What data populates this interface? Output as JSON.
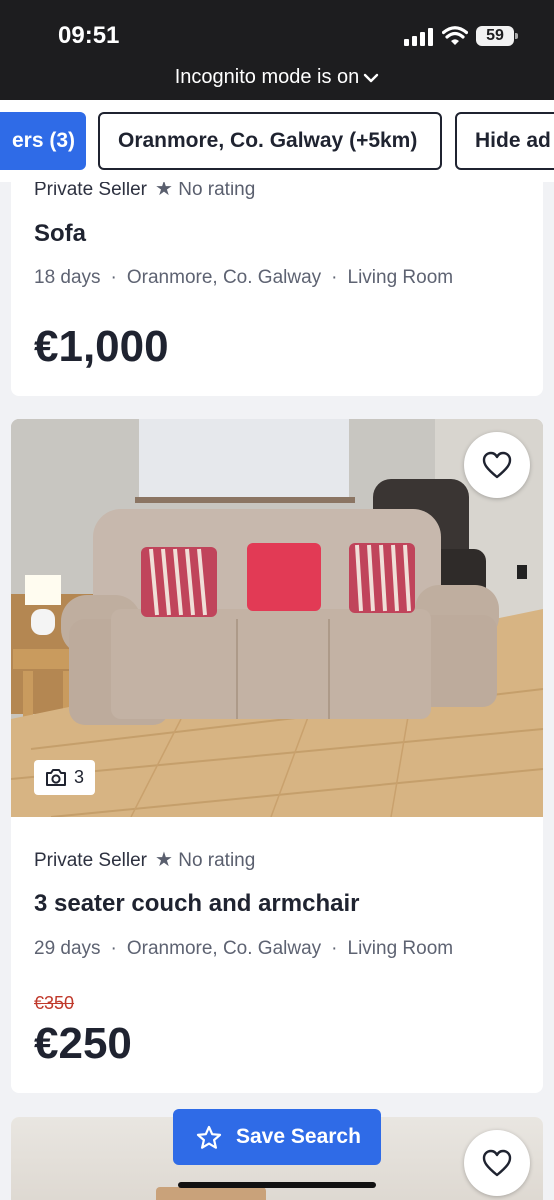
{
  "status_bar": {
    "time": "09:51",
    "battery": "59",
    "incognito_label": "Incognito mode is on"
  },
  "filters": {
    "active_chip": "ers (3)",
    "location_chip": "Oranmore, Co. Galway (+5km)",
    "hide_chip": "Hide ad"
  },
  "listings": [
    {
      "seller": "Private Seller",
      "rating": "No rating",
      "title": "Sofa",
      "age": "18 days",
      "location": "Oranmore, Co. Galway",
      "category": "Living Room",
      "price": "€1,000"
    },
    {
      "seller": "Private Seller",
      "rating": "No rating",
      "title": "3 seater couch and armchair",
      "age": "29 days",
      "location": "Oranmore, Co. Galway",
      "category": "Living Room",
      "old_price": "€350",
      "price": "€250",
      "photo_count": "3"
    }
  ],
  "save_search_label": "Save Search",
  "colors": {
    "accent": "#2f6be7",
    "status_bar": "#1d1d1f",
    "old_price": "#c0392b"
  },
  "icons": {
    "favorite": "heart-icon",
    "camera": "camera-icon",
    "save": "star-icon",
    "rating": "star-icon",
    "dropdown": "chevron-down-icon"
  }
}
